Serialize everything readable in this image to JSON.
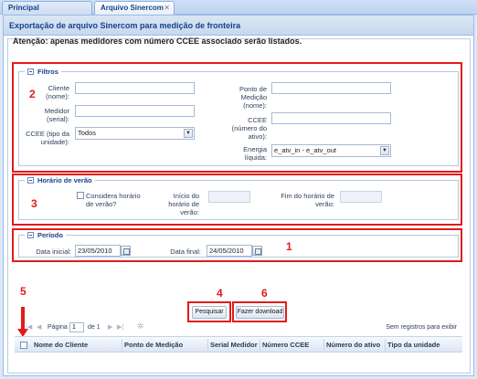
{
  "tabs": [
    {
      "label": "Principal"
    },
    {
      "label": "Arquivo Sinercom",
      "close": "✕"
    }
  ],
  "panel": {
    "title": "Exportação de arquivo Sinercom para medição de fronteira"
  },
  "attention": "Atenção: apenas medidores com número CCEE associado serão listados.",
  "filtros": {
    "legend": "Filtros",
    "cliente_label": "Cliente (nome):",
    "cliente_value": "",
    "medidor_label": "Medidor (serial):",
    "medidor_value": "",
    "ccee_tipo_label": "CCEE (tipo da unidade):",
    "ccee_tipo_value": "Todos",
    "ponto_label": "Ponto de Medição (nome):",
    "ponto_value": "",
    "ccee_num_label": "CCEE (número do ativo):",
    "ccee_num_value": "",
    "energia_label": "Energia líquida:",
    "energia_value": "e_atv_in - e_atv_out"
  },
  "horario": {
    "legend": "Horário de verão",
    "considera_label": "Considera horário de verão?",
    "inicio_label": "Início do horário de verão:",
    "inicio_value": "",
    "fim_label": "Fim do horário de verão:",
    "fim_value": ""
  },
  "periodo": {
    "legend": "Período",
    "inicial_label": "Data inicial:",
    "inicial_value": "23/05/2010",
    "final_label": "Data final:",
    "final_value": "24/05/2010"
  },
  "annotations": {
    "n1": "1",
    "n2": "2",
    "n3": "3",
    "n4": "4",
    "n5": "5",
    "n6": "6"
  },
  "buttons": {
    "pesquisar": "Pesquisar",
    "download": "Fazer download"
  },
  "pager": {
    "page_label": "Página",
    "page_value": "1",
    "of_label": "de 1",
    "status": "Sem registros para exibir"
  },
  "grid": {
    "columns": [
      "Nome do Cliente",
      "Ponto de Medição",
      "Serial Medidor",
      "Número CCEE",
      "Número do ativo",
      "Tipo da unidade"
    ]
  },
  "colors": {
    "annotation": "#e21b1b",
    "header_text": "#15428b"
  }
}
